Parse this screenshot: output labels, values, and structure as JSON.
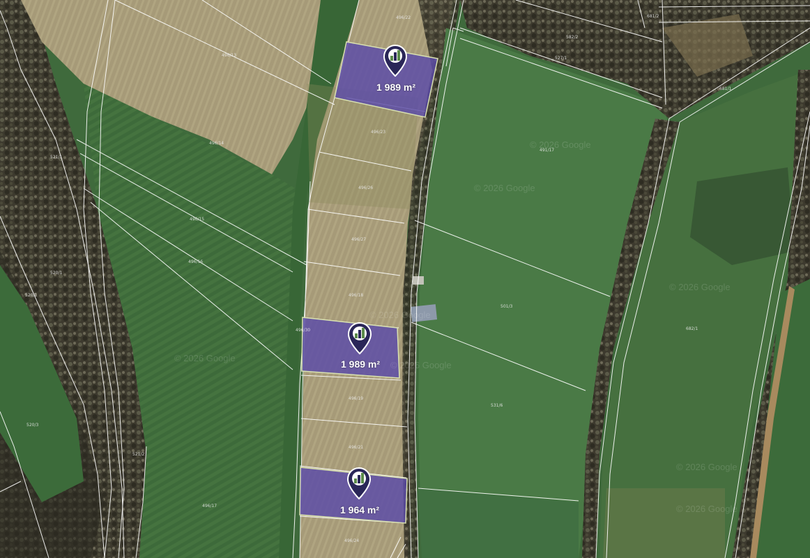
{
  "map": {
    "type": "satellite-cadastral",
    "colors": {
      "parcel_fill": "#5a4aa8",
      "parcel_border": "#d8e0b0",
      "marker": "#2a2658",
      "boundary_line": "#ffffff"
    },
    "watermark": "© 2026 Google",
    "highlighted_parcels": [
      {
        "id": "parcel-top",
        "area": "1 989 m²",
        "icon": "map-pin-buildings-icon"
      },
      {
        "id": "parcel-middle",
        "area": "1 989 m²",
        "icon": "map-pin-buildings-icon"
      },
      {
        "id": "parcel-bottom",
        "area": "1 964 m²",
        "icon": "map-pin-buildings-icon"
      }
    ],
    "parcel_numbers": [
      "496/13",
      "496/14",
      "496/15",
      "496/16",
      "496/17",
      "496/18",
      "496/19",
      "496/21",
      "496/22",
      "496/23",
      "496/24",
      "496/25",
      "496/26",
      "496/27",
      "491/17",
      "501/3",
      "531/6",
      "521/1",
      "520/1",
      "520/3",
      "521/2",
      "682/1",
      "582/2",
      "681/2",
      "681/1",
      "527/1",
      "496/30"
    ]
  }
}
